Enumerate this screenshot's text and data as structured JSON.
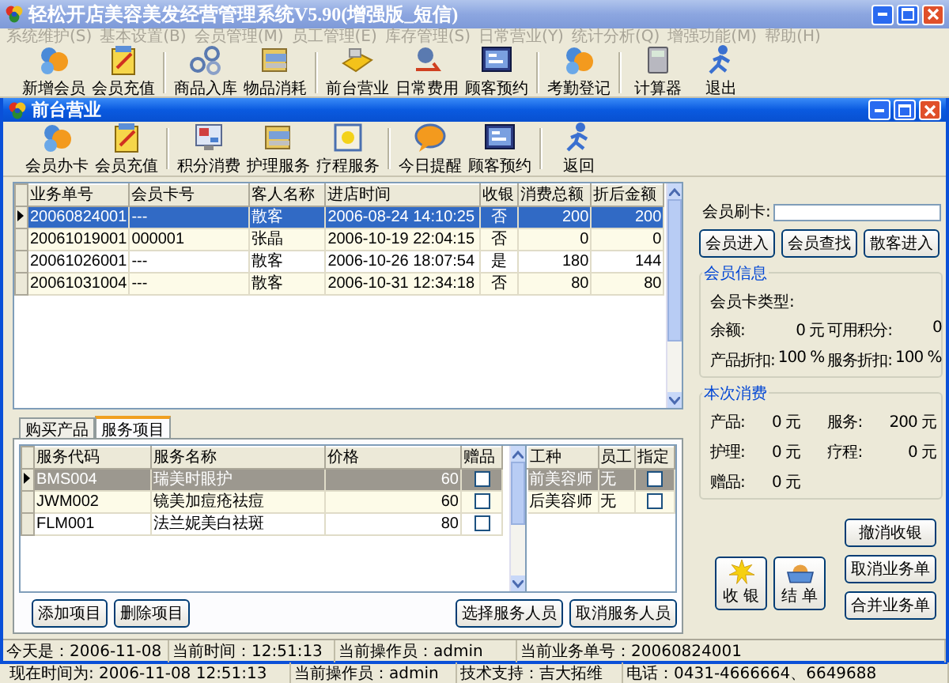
{
  "window": {
    "title": "轻松开店美容美发经营管理系统V5.90(增强版_短信)"
  },
  "menu": [
    {
      "label": "系统维护(S)",
      "disabled": true
    },
    {
      "label": "基本设置(B)",
      "disabled": true
    },
    {
      "label": "会员管理(M)",
      "disabled": true
    },
    {
      "label": "员工管理(E)",
      "disabled": true
    },
    {
      "label": "库存管理(S)",
      "disabled": true
    },
    {
      "label": "日常营业(Y)",
      "disabled": true
    },
    {
      "label": "统计分析(Q)",
      "disabled": true
    },
    {
      "label": "增强功能(M)",
      "disabled": true
    },
    {
      "label": "帮助(H)",
      "disabled": true
    }
  ],
  "toolbar_groups": [
    {
      "buttons": [
        "新增会员",
        "会员充值"
      ]
    },
    {
      "buttons": [
        "商品入库",
        "物品消耗"
      ]
    },
    {
      "buttons": [
        "前台营业",
        "日常费用",
        "顾客预约"
      ]
    },
    {
      "buttons": [
        "考勤登记"
      ]
    },
    {
      "buttons": [
        "计算器",
        "退出"
      ]
    }
  ],
  "inner_window": {
    "title": "前台营业",
    "toolbar_groups": [
      {
        "buttons": [
          "会员办卡",
          "会员充值"
        ]
      },
      {
        "buttons": [
          "积分消费",
          "护理服务",
          "疗程服务"
        ]
      },
      {
        "buttons": [
          "今日提醒",
          "顾客预约"
        ]
      },
      {
        "buttons": [
          "返回"
        ]
      }
    ],
    "orders_table": {
      "columns": [
        "业务单号",
        "会员卡号",
        "客人名称",
        "进店时间",
        "收银",
        "消费总额",
        "折后金额"
      ],
      "rows": [
        {
          "selected": true,
          "cells": [
            "20060824001",
            "---",
            "散客",
            "2006-08-24 14:10:25",
            "否",
            "200",
            "200"
          ]
        },
        {
          "selected": false,
          "cells": [
            "20061019001",
            "000001",
            "张晶",
            "2006-10-19 22:04:15",
            "否",
            "0",
            "0"
          ]
        },
        {
          "selected": false,
          "cells": [
            "20061026001",
            "---",
            "散客",
            "2006-10-26 18:07:54",
            "是",
            "180",
            "144"
          ]
        },
        {
          "selected": false,
          "cells": [
            "20061031004",
            "---",
            "散客",
            "2006-10-31 12:34:18",
            "否",
            "80",
            "80"
          ]
        }
      ]
    },
    "tabs": [
      {
        "label": "购买产品",
        "selected": false
      },
      {
        "label": "服务项目",
        "selected": true
      }
    ],
    "service_table": {
      "columns": [
        "服务代码",
        "服务名称",
        "价格",
        "赠品"
      ],
      "rows": [
        {
          "selected": true,
          "gift": false,
          "cells": [
            "BMS004",
            "瑞美时眼护",
            "60"
          ]
        },
        {
          "selected": false,
          "gift": false,
          "cells": [
            "JWM002",
            "镜美加痘疮祛痘",
            "60"
          ]
        },
        {
          "selected": false,
          "gift": false,
          "cells": [
            "FLM001",
            "法兰妮美白祛斑",
            "80"
          ]
        }
      ]
    },
    "staff_table": {
      "columns": [
        "工种",
        "员工",
        "指定"
      ],
      "rows": [
        {
          "selected": true,
          "assigned": false,
          "cells": [
            "前美容师",
            "无"
          ]
        },
        {
          "selected": false,
          "assigned": false,
          "cells": [
            "后美容师",
            "无"
          ]
        }
      ]
    },
    "service_buttons": [
      "添加项目",
      "删除项目"
    ],
    "staff_buttons": [
      "选择服务人员",
      "取消服务人员"
    ],
    "card_label": "会员刷卡:",
    "member_buttons": [
      "会员进入",
      "会员查找",
      "散客进入"
    ],
    "member_info": {
      "title": "会员信息",
      "card_type": "会员卡类型:",
      "rows": [
        [
          "余额:",
          "0 元",
          "可用积分:",
          "0"
        ],
        [
          "产品折扣:",
          "100 %",
          "服务折扣:",
          "100 %"
        ]
      ]
    },
    "consumption": {
      "title": "本次消费",
      "rows": [
        [
          "产品:",
          "0 元",
          "服务:",
          "200 元"
        ],
        [
          "护理:",
          "0 元",
          "疗程:",
          "0 元"
        ],
        [
          "赠品:",
          "0 元"
        ]
      ]
    },
    "big_buttons": [
      "收 银",
      "结 单"
    ],
    "side_buttons": [
      "撤消收银",
      "取消业务单",
      "合并业务单"
    ],
    "status_bar": [
      "今天是：2006-11-08",
      "当前时间：12:51:13",
      "当前操作员：admin",
      "当前业务单号：20060824001"
    ]
  },
  "status_bar": [
    "现在时间为: 2006-11-08 12:51:13",
    "当前操作员：admin",
    "技术支持：吉大拓维",
    "电话：0431-4666664、6649688"
  ]
}
